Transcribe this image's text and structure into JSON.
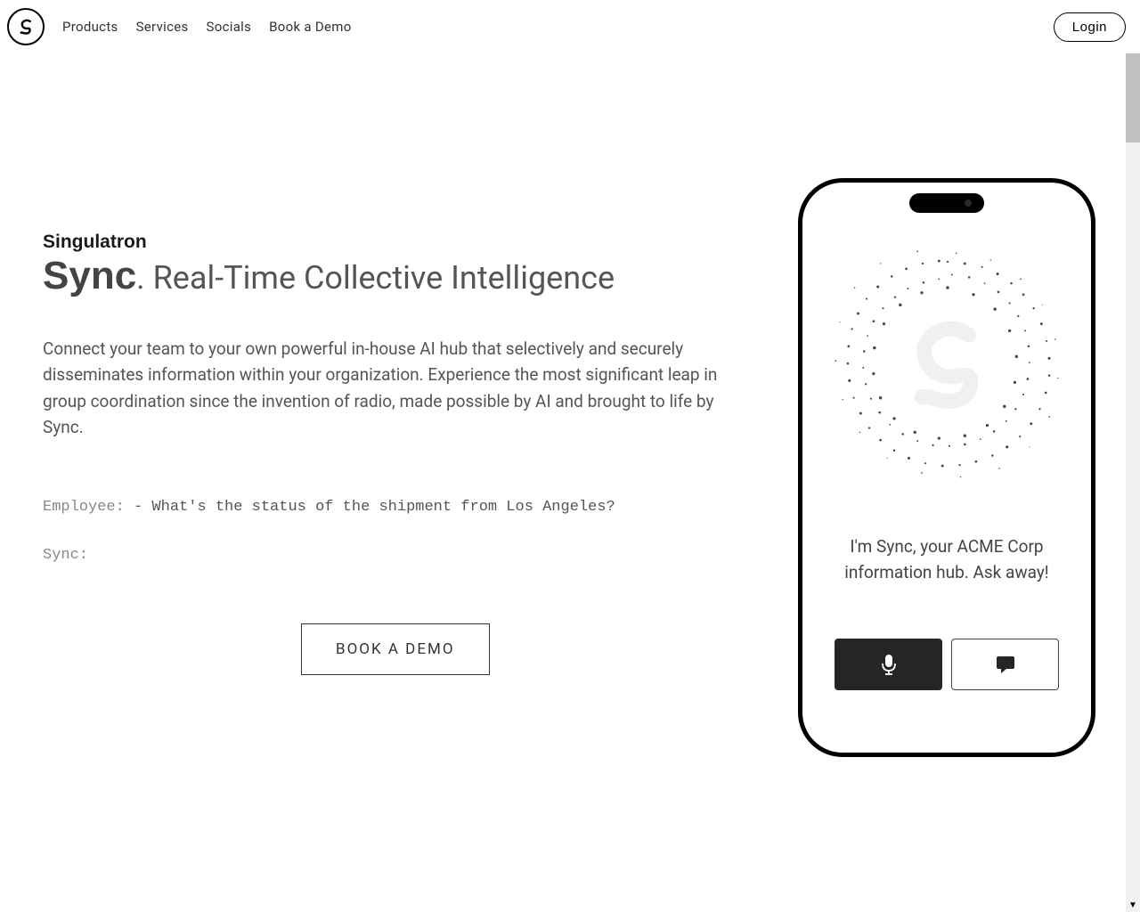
{
  "nav": {
    "items": [
      "Products",
      "Services",
      "Socials",
      "Book a Demo"
    ],
    "login": "Login"
  },
  "hero": {
    "brand": "Singulatron",
    "headline_bold": "Sync",
    "headline_rest": ". Real-Time Collective Intelligence",
    "description": "Connect your team to your own powerful in-house AI hub that selectively and securely disseminates information within your organization. Experience the most significant leap in group coordination since the invention of radio, made possible by AI and brought to life by Sync.",
    "chat": {
      "employee_label": "Employee:",
      "employee_text": " - What's the status of the shipment from Los Angeles?",
      "sync_label": "Sync:",
      "sync_text": ""
    },
    "cta": "BOOK A DEMO"
  },
  "phone": {
    "greeting": "I'm Sync, your ACME Corp information hub. Ask away!"
  }
}
